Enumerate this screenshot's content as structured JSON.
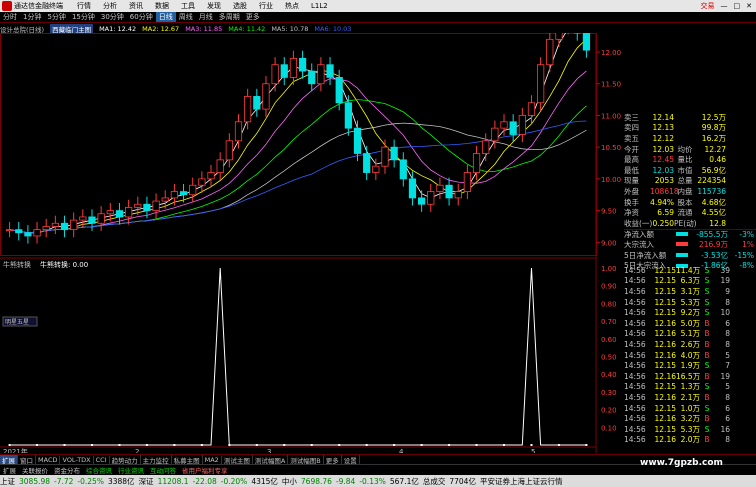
{
  "titlebar": {
    "app_name": "通达信金融终端",
    "menu": [
      "行情",
      "分析",
      "资讯",
      "数据",
      "工具",
      "发现",
      "选股",
      "行业",
      "热点",
      "L1L2"
    ],
    "right_label": "交易"
  },
  "periodbar": {
    "periods": [
      "分时",
      "1分钟",
      "5分钟",
      "15分钟",
      "30分钟",
      "60分钟",
      "日线",
      "周线",
      "月线",
      "多周期",
      "更多"
    ],
    "active": "日线"
  },
  "ma_line": {
    "title": "设计总院(日线)",
    "badge": "西藏临门主图",
    "items": [
      {
        "label": "MA1: 12.42",
        "color": "#ffffff"
      },
      {
        "label": "MA2: 12.67",
        "color": "#ffff00"
      },
      {
        "label": "MA3: 11.85",
        "color": "#ff66ff"
      },
      {
        "label": "MA4: 11.42",
        "color": "#00ff00"
      },
      {
        "label": "MA5: 10.78",
        "color": "#c0c0c0"
      },
      {
        "label": "MA6: 10.03",
        "color": "#3060ff"
      }
    ]
  },
  "price_axis": [
    "12.00",
    "11.50",
    "11.00",
    "10.50",
    "10.00",
    "9.50",
    "9.00"
  ],
  "indicator": {
    "name": "牛熊转换",
    "label": "牛熊转换: 0.00",
    "axis": [
      "1.00",
      "0.90",
      "0.80",
      "0.70",
      "0.60",
      "0.50",
      "0.40",
      "0.30",
      "0.20",
      "0.10"
    ],
    "sub_label": "明星五星"
  },
  "x_axis": {
    "labels": [
      "2021年",
      "2",
      "3",
      "4",
      "5"
    ]
  },
  "chart_data": {
    "type": "candlestick",
    "close_series": [
      9.2,
      9.15,
      9.1,
      9.2,
      9.25,
      9.3,
      9.2,
      9.35,
      9.4,
      9.3,
      9.45,
      9.5,
      9.4,
      9.55,
      9.6,
      9.5,
      9.65,
      9.7,
      9.8,
      9.75,
      9.9,
      10.0,
      10.1,
      10.3,
      10.6,
      10.9,
      11.3,
      11.1,
      11.5,
      11.8,
      11.6,
      11.9,
      11.7,
      11.5,
      11.8,
      11.6,
      11.2,
      10.8,
      10.4,
      10.1,
      10.2,
      10.5,
      10.3,
      10.0,
      9.7,
      9.6,
      9.8,
      9.9,
      9.7,
      9.8,
      10.1,
      10.4,
      10.6,
      10.8,
      10.9,
      10.7,
      11.0,
      11.2,
      11.8,
      12.2,
      12.4,
      12.5,
      12.3,
      12.03
    ],
    "indicator_series_peaks": [
      {
        "index": 23,
        "value": 1.0
      },
      {
        "index": 57,
        "value": 1.0
      }
    ],
    "ylim": [
      8.8,
      12.3
    ]
  },
  "quote": {
    "rows": [
      {
        "l": "卖三",
        "v1": "12.14",
        "c1": "#ffff00",
        "l2": "",
        "v2": "12.5万",
        "c2": "#ffff00"
      },
      {
        "l": "卖四",
        "v1": "12.13",
        "c1": "#ffff00",
        "l2": "",
        "v2": "99.8万",
        "c2": "#ffff00"
      },
      {
        "l": "卖五",
        "v1": "12.12",
        "c1": "#ffff00",
        "l2": "",
        "v2": "16.2万",
        "c2": "#ffff00"
      },
      {
        "l": "今开",
        "v1": "12.03",
        "c1": "#ffff00",
        "l2": "均价",
        "v2": "12.27",
        "c2": "#ffff00"
      },
      {
        "l": "最高",
        "v1": "12.45",
        "c1": "#ff3b3b",
        "l2": "量比",
        "v2": "0.46",
        "c2": "#ffff00"
      },
      {
        "l": "最低",
        "v1": "12.03",
        "c1": "#00e0e0",
        "l2": "市值",
        "v2": "56.9亿",
        "c2": "#ffff00"
      },
      {
        "l": "现量",
        "v1": "2053",
        "c1": "#ffff00",
        "l2": "总量",
        "v2": "224354",
        "c2": "#ffff00"
      },
      {
        "l": "外盘",
        "v1": "108618",
        "c1": "#ff3b3b",
        "l2": "内盘",
        "v2": "115736",
        "c2": "#00e0e0"
      },
      {
        "l": "换手",
        "v1": "4.94%",
        "c1": "#ffff00",
        "l2": "股本",
        "v2": "4.68亿",
        "c2": "#ffff00"
      },
      {
        "l": "净资",
        "v1": "6.59",
        "c1": "#ffff00",
        "l2": "流通",
        "v2": "4.55亿",
        "c2": "#ffff00"
      },
      {
        "l": "收益(一)",
        "v1": "0.250",
        "c1": "#ffff00",
        "l2": "PE(动)",
        "v2": "12.8",
        "c2": "#ffff00"
      }
    ],
    "flows": [
      {
        "l": "净流入额",
        "v": "-855.5万",
        "vc": "#00e0e0",
        "p": "-3%",
        "pc": "#00e0e0"
      },
      {
        "l": "大宗流入",
        "v": "216.9万",
        "vc": "#ff3b3b",
        "p": "1%",
        "pc": "#ff3b3b"
      },
      {
        "l": "5日净流入额",
        "v": "-3.53亿",
        "vc": "#00e0e0",
        "p": "-15%",
        "pc": "#00e0e0"
      },
      {
        "l": "5日大宗流入",
        "v": "-1.86亿",
        "vc": "#00e0e0",
        "p": "-8%",
        "pc": "#00e0e0"
      }
    ]
  },
  "ticks": [
    {
      "t": "14:56",
      "p": "12.15",
      "v": "11.4万",
      "s": "S",
      "n": "39"
    },
    {
      "t": "14:56",
      "p": "12.15",
      "v": "6.3万",
      "s": "S",
      "n": "19"
    },
    {
      "t": "14:56",
      "p": "12.15",
      "v": "3.1万",
      "s": "S",
      "n": "9"
    },
    {
      "t": "14:56",
      "p": "12.15",
      "v": "5.3万",
      "s": "S",
      "n": "8"
    },
    {
      "t": "14:56",
      "p": "12.15",
      "v": "9.2万",
      "s": "S",
      "n": "10"
    },
    {
      "t": "14:56",
      "p": "12.16",
      "v": "5.0万",
      "s": "B",
      "n": "6"
    },
    {
      "t": "14:56",
      "p": "12.16",
      "v": "5.1万",
      "s": "B",
      "n": "8"
    },
    {
      "t": "14:56",
      "p": "12.16",
      "v": "2.6万",
      "s": "B",
      "n": "8"
    },
    {
      "t": "14:56",
      "p": "12.16",
      "v": "4.0万",
      "s": "B",
      "n": "5"
    },
    {
      "t": "14:56",
      "p": "12.15",
      "v": "1.9万",
      "s": "S",
      "n": "7"
    },
    {
      "t": "14:56",
      "p": "12.16",
      "v": "16.5万",
      "s": "B",
      "n": "19"
    },
    {
      "t": "14:56",
      "p": "12.15",
      "v": "1.3万",
      "s": "S",
      "n": "5"
    },
    {
      "t": "14:56",
      "p": "12.16",
      "v": "2.1万",
      "s": "B",
      "n": "8"
    },
    {
      "t": "14:56",
      "p": "12.15",
      "v": "1.0万",
      "s": "S",
      "n": "6"
    },
    {
      "t": "14:56",
      "p": "12.16",
      "v": "3.2万",
      "s": "B",
      "n": "6"
    },
    {
      "t": "14:56",
      "p": "12.15",
      "v": "5.3万",
      "s": "S",
      "n": "16"
    },
    {
      "t": "14:56",
      "p": "12.16",
      "v": "2.0万",
      "s": "B",
      "n": "8"
    }
  ],
  "bottom_tabs": [
    "扩展",
    "窗口",
    "MACD",
    "VOL-TDX",
    "CCI",
    "趋势动力",
    "主力监控",
    "私募主图",
    "MA2",
    "测试主图",
    "测试幅图A",
    "测试幅图B",
    "更多",
    "设置"
  ],
  "news_tabs": [
    "扩展",
    "关联报价",
    "资金分布",
    "综合资讯",
    "行业资讯",
    "互动问答",
    "省用户福利专享"
  ],
  "watermark": "www.7gpzb.com",
  "statusbar": [
    {
      "t": "上证",
      "c": "#000000"
    },
    {
      "t": "3085.98",
      "c": "#008000"
    },
    {
      "t": "-7.72",
      "c": "#008000"
    },
    {
      "t": "-0.25%",
      "c": "#008000"
    },
    {
      "t": "3388亿",
      "c": "#000000"
    },
    {
      "t": "深证",
      "c": "#000000"
    },
    {
      "t": "11208.1",
      "c": "#008000"
    },
    {
      "t": "-22.08",
      "c": "#008000"
    },
    {
      "t": "-0.20%",
      "c": "#008000"
    },
    {
      "t": "4315亿",
      "c": "#000000"
    },
    {
      "t": "中小",
      "c": "#000000"
    },
    {
      "t": "7698.76",
      "c": "#008000"
    },
    {
      "t": "-9.84",
      "c": "#008000"
    },
    {
      "t": "-0.13%",
      "c": "#008000"
    },
    {
      "t": "567.1亿",
      "c": "#000000"
    },
    {
      "t": "总成交",
      "c": "#000000"
    },
    {
      "t": "7704亿",
      "c": "#000000"
    },
    {
      "t": "平安证券上海上证云行情",
      "c": "#000000"
    }
  ]
}
